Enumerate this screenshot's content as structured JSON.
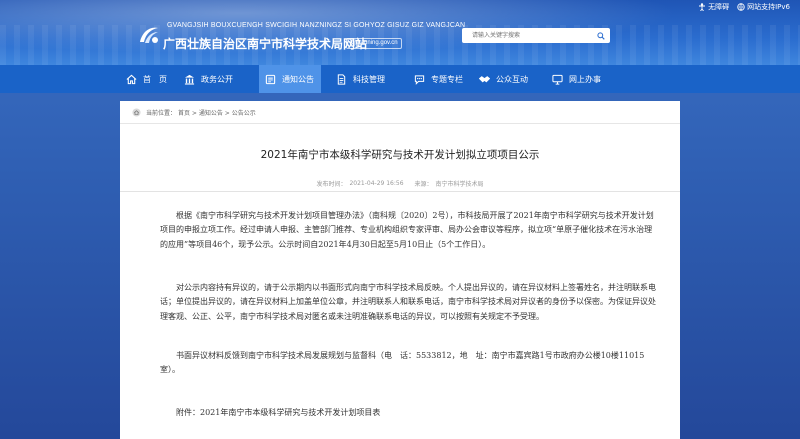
{
  "header": {
    "site_name_en": "GVANGJSIH BOUXCUENGH SWCIGIH NANZNINGZ SI GOHYOZ GISUZ GIZ VANGJCAN",
    "site_name_cn": "广西壮族自治区南宁市科学技术局网站",
    "domain": "kjj.nanning.gov.cn",
    "top_links": [
      "无障碍",
      "网站支持IPv6"
    ],
    "search_placeholder": "请输入关键字搜索"
  },
  "nav": {
    "items": [
      {
        "label": "首　页",
        "icon": "home-icon"
      },
      {
        "label": "政务公开",
        "icon": "building-icon"
      },
      {
        "label": "通知公告",
        "icon": "notice-icon"
      },
      {
        "label": "科技管理",
        "icon": "document-icon"
      },
      {
        "label": "专题专栏",
        "icon": "chat-icon"
      },
      {
        "label": "公众互动",
        "icon": "handshake-icon"
      },
      {
        "label": "网上办事",
        "icon": "monitor-icon"
      }
    ],
    "active_index": 2,
    "active_color": "#4f93e8",
    "bar_color": "#1a63c8"
  },
  "breadcrumb": {
    "prefix": "当前位置：",
    "path": "首页 > 通知公告 > 公告公示"
  },
  "article": {
    "title": "2021年南宁市本级科学研究与技术开发计划拟立项项目公示",
    "publish_label": "发布时间：",
    "publish_time": "2021-04-29 16:56",
    "source_label": "来源：",
    "source": "南宁市科学技术局",
    "paragraphs": [
      "根据《南宁市科学研究与技术开发计划项目管理办法》（南科规〔2020〕2号），市科技局开展了2021年南宁市科学研究与技术开发计划项目的申报立项工作。经过申请人申报、主管部门推荐、专业机构组织专家评审、局办公会审议等程序，拟立项“单原子催化技术在污水治理的应用”等项目46个，现予公示。公示时间自2021年4月30日起至5月10日止（5个工作日）。",
      "对公示内容持有异议的，请于公示期内以书面形式向南宁市科学技术局反映。个人提出异议的，请在异议材料上签署姓名，并注明联系电话；单位提出异议的，请在异议材料上加盖单位公章，并注明联系人和联系电话，南宁市科学技术局对异议者的身份予以保密。为保证异议处理客观、公正、公平，南宁市科学技术局对匿名或未注明准确联系电话的异议，可以按照有关规定不予受理。",
      "书面异议材料反馈到南宁市科学技术局发展规划与监督科（电　话：5533812，地　址：南宁市嘉宾路1号市政府办公楼10楼11015室）。",
      "附件：2021年南宁市本级科学研究与技术开发计划项目表"
    ]
  }
}
